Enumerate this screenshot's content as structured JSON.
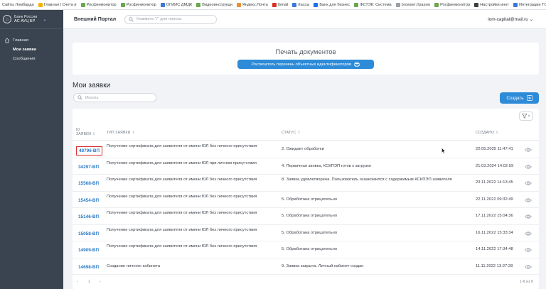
{
  "bookmarks": [
    {
      "label": "Сайты Ломбарда",
      "color": "#ffffff"
    },
    {
      "label": "Главная | Счета и",
      "color": "#f4b400"
    },
    {
      "label": "Росфинмонитор",
      "color": "#6aa84f"
    },
    {
      "label": "Росфинмонитор",
      "color": "#6aa84f"
    },
    {
      "label": "ОГИИС ДМДК",
      "color": "#3c78d8"
    },
    {
      "label": "Видеоинструкци",
      "color": "#6aa84f"
    },
    {
      "label": "Яндекс.Почта",
      "color": "#e69138"
    },
    {
      "label": "Gmail",
      "color": "#d93025"
    },
    {
      "label": "Кассы",
      "color": "#3c78d8"
    },
    {
      "label": "Банк для бизнес",
      "color": "#1a73e8"
    },
    {
      "label": "ФСТЭК: Система",
      "color": "#6aa84f"
    },
    {
      "label": "browser://passw",
      "color": "#9aa0a6"
    },
    {
      "label": "Росфинмонитор",
      "color": "#6aa84f"
    },
    {
      "label": "Настройки иннт",
      "color": "#3c4043"
    },
    {
      "label": "Интеграции ТС",
      "color": "#3c78d8"
    }
  ],
  "sidebar": {
    "brand_line1": "Банк России",
    "brand_line2": "АС АУЦ БР",
    "items": [
      {
        "label": "Главная"
      },
      {
        "label": "Мои заявки"
      },
      {
        "label": "Сообщения"
      }
    ]
  },
  "header": {
    "title": "Внешний Портал",
    "search_placeholder": "Нажмите \"/\" для поиска",
    "user": "lom-capital@mail.ru"
  },
  "print": {
    "title": "Печать документов",
    "button": "Распечатать перечень объектных идентификаторов"
  },
  "requests": {
    "title": "Мои заявки",
    "search_placeholder": "Искать",
    "create_button": "Создать",
    "columns": {
      "id_line1": "ID",
      "id_line2": "заявки",
      "type": "Тип заявки",
      "status": "Статус",
      "created": "Создано"
    },
    "rows": [
      {
        "id": "48796-ВП",
        "type": "Получение сертификата для заявителя от имени ЮЛ без личного присутствия",
        "status": "2. Ожидает обработки",
        "created": "22.05.2025 11:47:41"
      },
      {
        "id": "34297-ВП",
        "type": "Получение сертификата для заявителя от имени ЮЛ при личном присутствии",
        "status": "4. Первичная заявка, КСКПЭП готов к загрузке",
        "created": "21.03.2024 14:02:59"
      },
      {
        "id": "15568-ВП",
        "type": "Получение сертификата для заявителя от имени ЮЛ без личного присутствия",
        "status": "8. Заявка удовлетворена. Пользователь ознакомился с содержимым КСКПЭП заявителя",
        "created": "23.11.2022 14:13:45"
      },
      {
        "id": "15454-ВП",
        "type": "Получение сертификата для заявителя от имени ЮЛ без личного присутствия",
        "status": "5. Обработана отрицательно",
        "created": "22.11.2022 09:32:49"
      },
      {
        "id": "15146-ВП",
        "type": "Получение сертификата для заявителя от имени ЮЛ без личного присутствия",
        "status": "5. Обработана отрицательно",
        "created": "17.11.2022 15:04:36"
      },
      {
        "id": "15058-ВП",
        "type": "Получение сертификата для заявителя от имени ЮЛ без личного присутствия",
        "status": "5. Обработана отрицательно",
        "created": "16.11.2022 15:33:34"
      },
      {
        "id": "14909-ВП",
        "type": "Получение сертификата для заявителя от имени ЮЛ без личного присутствия",
        "status": "5. Обработана отрицательно",
        "created": "14.11.2022 17:34:48"
      },
      {
        "id": "14698-ВП",
        "type": "Создание личного кабинета",
        "status": "9. Заявка закрыта. Личный кабинет создан",
        "created": "11.11.2022 13:27:28"
      }
    ],
    "pager": {
      "prev": "‹",
      "page": "1",
      "next": "›",
      "count": "1-8 из 8"
    }
  },
  "colors": {
    "accent": "#2d8bd8",
    "sidebar": "#3a4450",
    "link": "#2a79c4",
    "highlight": "#d9302b"
  }
}
